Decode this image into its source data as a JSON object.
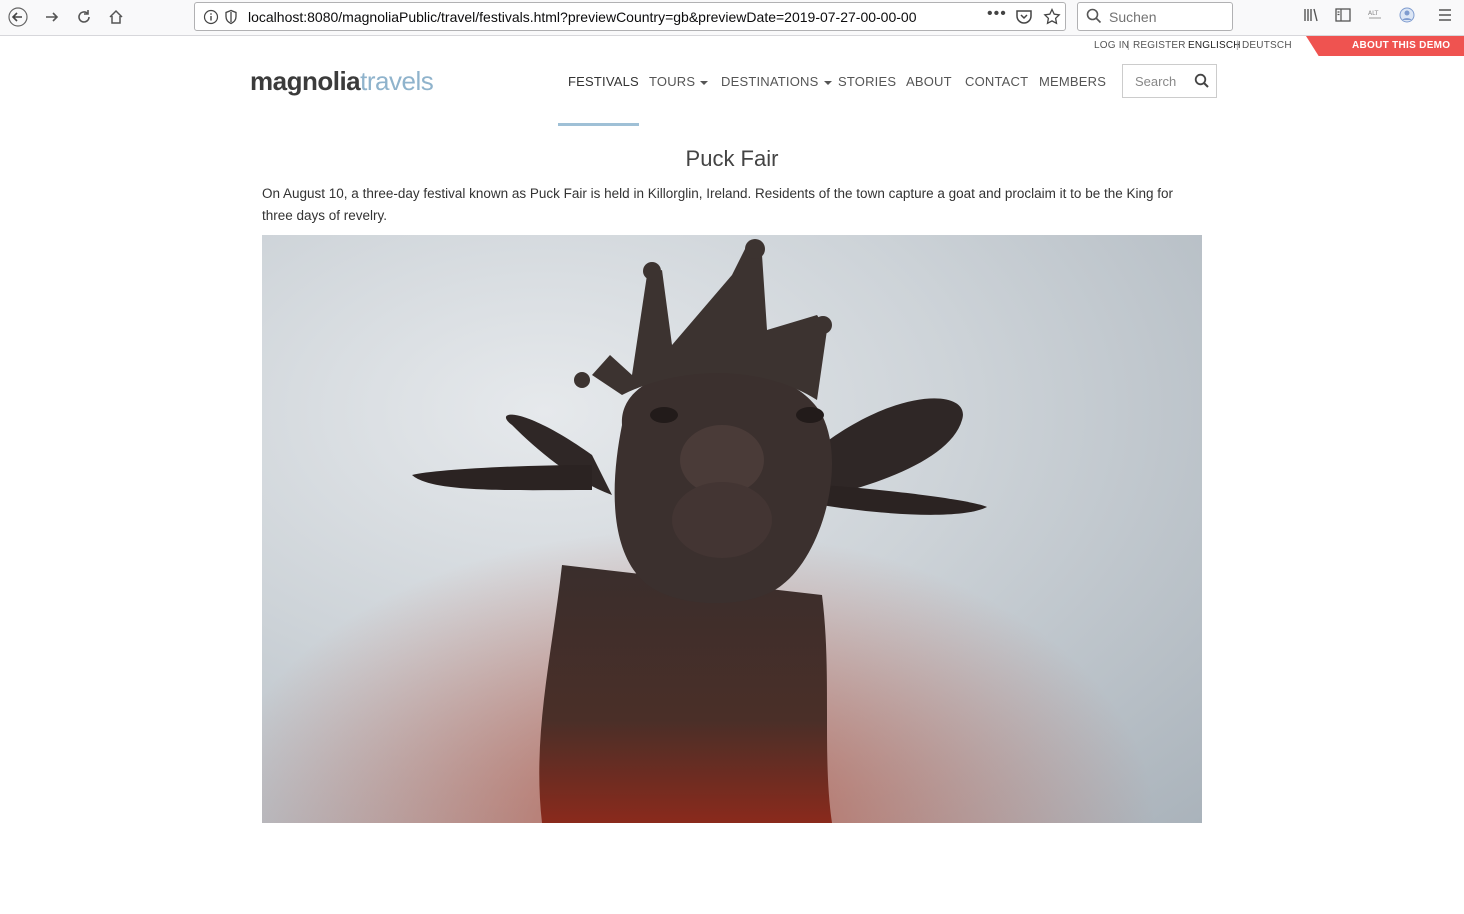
{
  "browser": {
    "url": "localhost:8080/magnoliaPublic/travel/festivals.html?previewCountry=gb&previewDate=2019-07-27-00-00-00",
    "search_placeholder": "Suchen"
  },
  "utility": {
    "login": "LOG IN",
    "register": "REGISTER",
    "lang_en": "ENGLISCH",
    "lang_de": "DEUTSCH",
    "separator": "|",
    "about_demo": "ABOUT THIS DEMO"
  },
  "logo": {
    "part1": "magnolia",
    "part2": "travels"
  },
  "nav": {
    "items": [
      {
        "label": "FESTIVALS"
      },
      {
        "label": "TOURS"
      },
      {
        "label": "DESTINATIONS"
      },
      {
        "label": "STORIES"
      },
      {
        "label": "ABOUT"
      },
      {
        "label": "CONTACT"
      },
      {
        "label": "MEMBERS"
      }
    ],
    "search_placeholder": "Search"
  },
  "article": {
    "title": "Puck Fair",
    "description": "On August 10, a three-day festival known as Puck Fair is held in Killorglin, Ireland. Residents of the town capture a goat and proclaim it to be the King for three days of revelry."
  },
  "colors": {
    "accent": "#9fc0d6",
    "demo_ribbon": "#ef5350",
    "logo_dark": "#3b3b3b",
    "logo_light": "#8fb3cc"
  }
}
